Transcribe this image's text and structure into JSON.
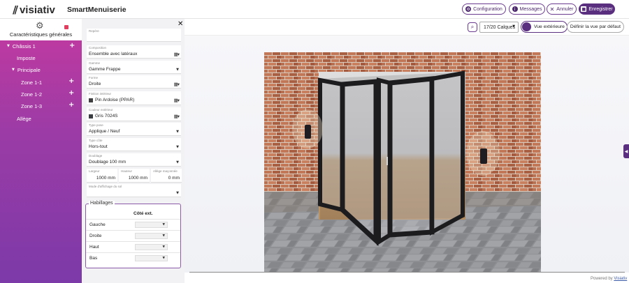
{
  "header": {
    "logo_text": "visiativ",
    "app_title": "SmartMenuiserie",
    "buttons": {
      "configuration": "Configuration",
      "messages": "Messages",
      "annuler": "Annuler",
      "enregistrer": "Enregistrer"
    }
  },
  "sidebar": {
    "general_label": "Caractéristiques générales",
    "tree": [
      {
        "label": "Châssis 1",
        "level": 0,
        "expanded": true
      },
      {
        "label": "Imposte",
        "level": 1
      },
      {
        "label": "Principale",
        "level": 1,
        "expanded": true
      },
      {
        "label": "Zone 1-1",
        "level": 2
      },
      {
        "label": "Zone 1-2",
        "level": 2
      },
      {
        "label": "Zone 1-3",
        "level": 2
      },
      {
        "label": "Allège",
        "level": 1
      }
    ]
  },
  "panel": {
    "repere": {
      "label": "Repère",
      "value": ""
    },
    "composition": {
      "label": "Composition",
      "value": "Ensemble avec latéraux"
    },
    "gamme": {
      "label": "Gamme",
      "value": "Gamme Frappe"
    },
    "forme": {
      "label": "Forme",
      "value": "Droite"
    },
    "finition": {
      "label": "Finition intérieur",
      "value": "Pin Ardoise (PPAR)",
      "color": "#3e3e40"
    },
    "couleur": {
      "label": "Couleur extérieur",
      "value": "Gris 7024S",
      "color": "#3a3d42"
    },
    "type_pose": {
      "label": "Type pose",
      "value": "Applique / Neuf"
    },
    "type_cote": {
      "label": "Type côte",
      "value": "Hors-tout"
    },
    "doublage": {
      "label": "Doublage",
      "value": "Doublage 100 mm"
    },
    "largeur": {
      "label": "Largeur",
      "value": "1000 mm"
    },
    "hauteur": {
      "label": "Hauteur",
      "value": "1000 mm"
    },
    "allege": {
      "label": "Allège maçonnée",
      "value": "0 mm"
    },
    "mode_sol": {
      "label": "Mode d'affichage du sol",
      "value": ""
    },
    "habillages": {
      "title": "Habillages",
      "column": "Côté ext.",
      "rows": [
        "Gauche",
        "Droite",
        "Haut",
        "Bas"
      ]
    }
  },
  "viewer": {
    "layers": "17/20 Calques",
    "exterior_toggle": "Vue extérieure",
    "default_view": "Définir la vue par défaut",
    "powered_by": "Powered by",
    "powered_link": "Visiativ"
  },
  "icons": {
    "gear": "gear-icon",
    "close": "close-icon",
    "zoom": "zoom-icon",
    "trash": "trash-icon",
    "add": "plus-icon",
    "panel_toggle": "chevron-left-icon"
  },
  "colors": {
    "brand_purple": "#5b2f80",
    "sidebar_top": "#c33aa0",
    "sidebar_bottom": "#7c3aa8",
    "brick": "#b36a4a",
    "door_frame": "#1f1f22"
  }
}
